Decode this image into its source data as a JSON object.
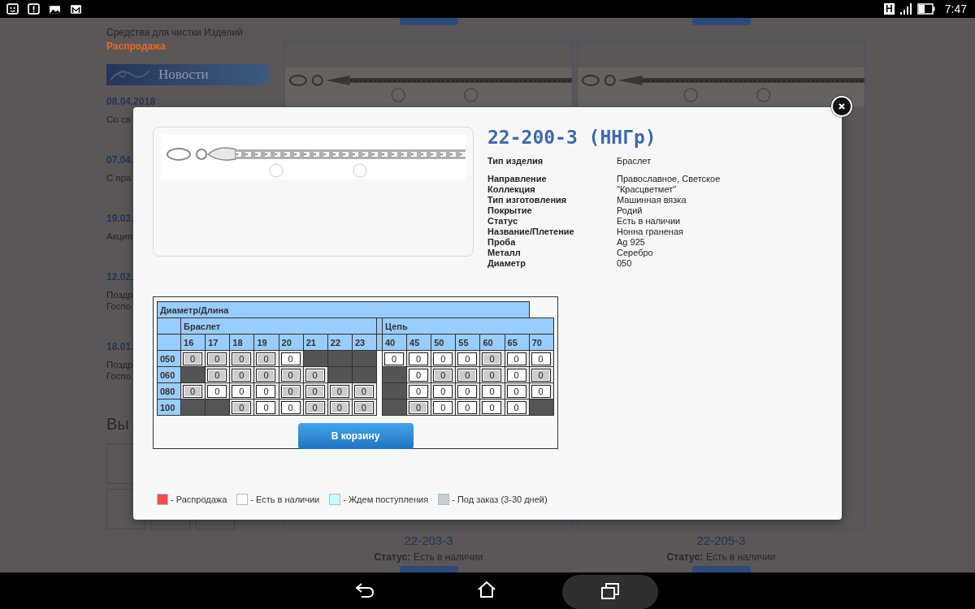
{
  "status_bar": {
    "network": "H",
    "time": "7:47"
  },
  "page": {
    "sidebar_links": [
      {
        "label": "Средства для чистки Изделий",
        "kind": "link"
      },
      {
        "label": "Распродажа",
        "kind": "sale"
      }
    ],
    "news_title": "Новости",
    "news": [
      {
        "date": "08.04.2018",
        "lines": [
          "Со св"
        ]
      },
      {
        "date": "07.04.",
        "lines": [
          "С пра"
        ]
      },
      {
        "date": "19.03.",
        "lines": [
          "Акция"
        ]
      },
      {
        "date": "12.02.",
        "lines": [
          "Поздр",
          "Госпо"
        ]
      },
      {
        "date": "18.01.",
        "lines": [
          "Поздр",
          "Госпо"
        ]
      }
    ],
    "viewed_title": "Вы",
    "products": [
      {
        "code": "22-203-3",
        "status_label": "Статус:",
        "status": "Есть в наличии"
      },
      {
        "code": "22-205-3",
        "status_label": "Статус:",
        "status": "Есть в наличии"
      }
    ]
  },
  "modal": {
    "title": "22-200-3 (ННГр)",
    "spec_groups": [
      [
        {
          "label": "Тип изделия",
          "value": "Браслет"
        }
      ],
      [
        {
          "label": "Направление",
          "value": "Православное, Светское"
        },
        {
          "label": "Коллекция",
          "value": "\"Красцветмет\""
        },
        {
          "label": "Тип изготовления",
          "value": "Машинная вязка"
        },
        {
          "label": "Покрытие",
          "value": "Родий"
        },
        {
          "label": "Статус",
          "value": "Есть в наличии"
        },
        {
          "label": "Название/Плетение",
          "value": "Нонна граненая"
        },
        {
          "label": "Проба",
          "value": "Ag 925"
        },
        {
          "label": "Металл",
          "value": "Серебро"
        },
        {
          "label": "Диаметр",
          "value": "050"
        }
      ]
    ],
    "table": {
      "header": "Диаметр/Длина",
      "groups": [
        {
          "label": "Браслет",
          "sizes": [
            "16",
            "17",
            "18",
            "19",
            "20",
            "21",
            "22",
            "23"
          ]
        },
        {
          "label": "Цепь",
          "sizes": [
            "40",
            "45",
            "50",
            "55",
            "60",
            "65",
            "70"
          ]
        }
      ],
      "rows": [
        {
          "diameter": "050",
          "cells": [
            [
              {
                "kind": "order",
                "qty": "0"
              },
              {
                "kind": "order",
                "qty": "0"
              },
              {
                "kind": "order",
                "qty": "0"
              },
              {
                "kind": "order",
                "qty": "0"
              },
              {
                "kind": "stock",
                "qty": "0"
              },
              {
                "kind": "none"
              },
              {
                "kind": "none"
              },
              {
                "kind": "none"
              }
            ],
            [
              {
                "kind": "stock",
                "qty": "0"
              },
              {
                "kind": "stock",
                "qty": "0"
              },
              {
                "kind": "stock",
                "qty": "0"
              },
              {
                "kind": "stock",
                "qty": "0"
              },
              {
                "kind": "order",
                "qty": "0"
              },
              {
                "kind": "stock",
                "qty": "0"
              },
              {
                "kind": "stock",
                "qty": "0"
              }
            ]
          ]
        },
        {
          "diameter": "060",
          "cells": [
            [
              {
                "kind": "none"
              },
              {
                "kind": "order",
                "qty": "0"
              },
              {
                "kind": "order",
                "qty": "0"
              },
              {
                "kind": "order",
                "qty": "0"
              },
              {
                "kind": "order",
                "qty": "0"
              },
              {
                "kind": "order",
                "qty": "0"
              },
              {
                "kind": "none"
              },
              {
                "kind": "none"
              }
            ],
            [
              {
                "kind": "none"
              },
              {
                "kind": "stock",
                "qty": "0"
              },
              {
                "kind": "order",
                "qty": "0"
              },
              {
                "kind": "order",
                "qty": "0"
              },
              {
                "kind": "order",
                "qty": "0"
              },
              {
                "kind": "stock",
                "qty": "0"
              },
              {
                "kind": "order",
                "qty": "0"
              }
            ]
          ]
        },
        {
          "diameter": "080",
          "cells": [
            [
              {
                "kind": "order",
                "qty": "0"
              },
              {
                "kind": "stock",
                "qty": "0"
              },
              {
                "kind": "stock",
                "qty": "0"
              },
              {
                "kind": "stock",
                "qty": "0"
              },
              {
                "kind": "order",
                "qty": "0"
              },
              {
                "kind": "order",
                "qty": "0"
              },
              {
                "kind": "order",
                "qty": "0"
              },
              {
                "kind": "order",
                "qty": "0"
              }
            ],
            [
              {
                "kind": "none"
              },
              {
                "kind": "stock",
                "qty": "0"
              },
              {
                "kind": "stock",
                "qty": "0"
              },
              {
                "kind": "stock",
                "qty": "0"
              },
              {
                "kind": "stock",
                "qty": "0"
              },
              {
                "kind": "stock",
                "qty": "0"
              },
              {
                "kind": "stock",
                "qty": "0"
              }
            ]
          ]
        },
        {
          "diameter": "100",
          "cells": [
            [
              {
                "kind": "none"
              },
              {
                "kind": "none"
              },
              {
                "kind": "order",
                "qty": "0"
              },
              {
                "kind": "stock",
                "qty": "0"
              },
              {
                "kind": "stock",
                "qty": "0"
              },
              {
                "kind": "order",
                "qty": "0"
              },
              {
                "kind": "order",
                "qty": "0"
              },
              {
                "kind": "order",
                "qty": "0"
              }
            ],
            [
              {
                "kind": "none"
              },
              {
                "kind": "order",
                "qty": "0"
              },
              {
                "kind": "stock",
                "qty": "0"
              },
              {
                "kind": "stock",
                "qty": "0"
              },
              {
                "kind": "stock",
                "qty": "0"
              },
              {
                "kind": "stock",
                "qty": "0"
              },
              {
                "kind": "none"
              }
            ]
          ]
        }
      ]
    },
    "button": "В корзину",
    "legend": [
      {
        "label": "- Распродажа",
        "color": "#f44b4b"
      },
      {
        "label": "- Есть в наличии",
        "color": "#ffffff"
      },
      {
        "label": "- Ждем поступления",
        "color": "#ccffff"
      },
      {
        "label": "- Под заказ (3-30 дней)",
        "color": "#cccccc"
      }
    ]
  }
}
